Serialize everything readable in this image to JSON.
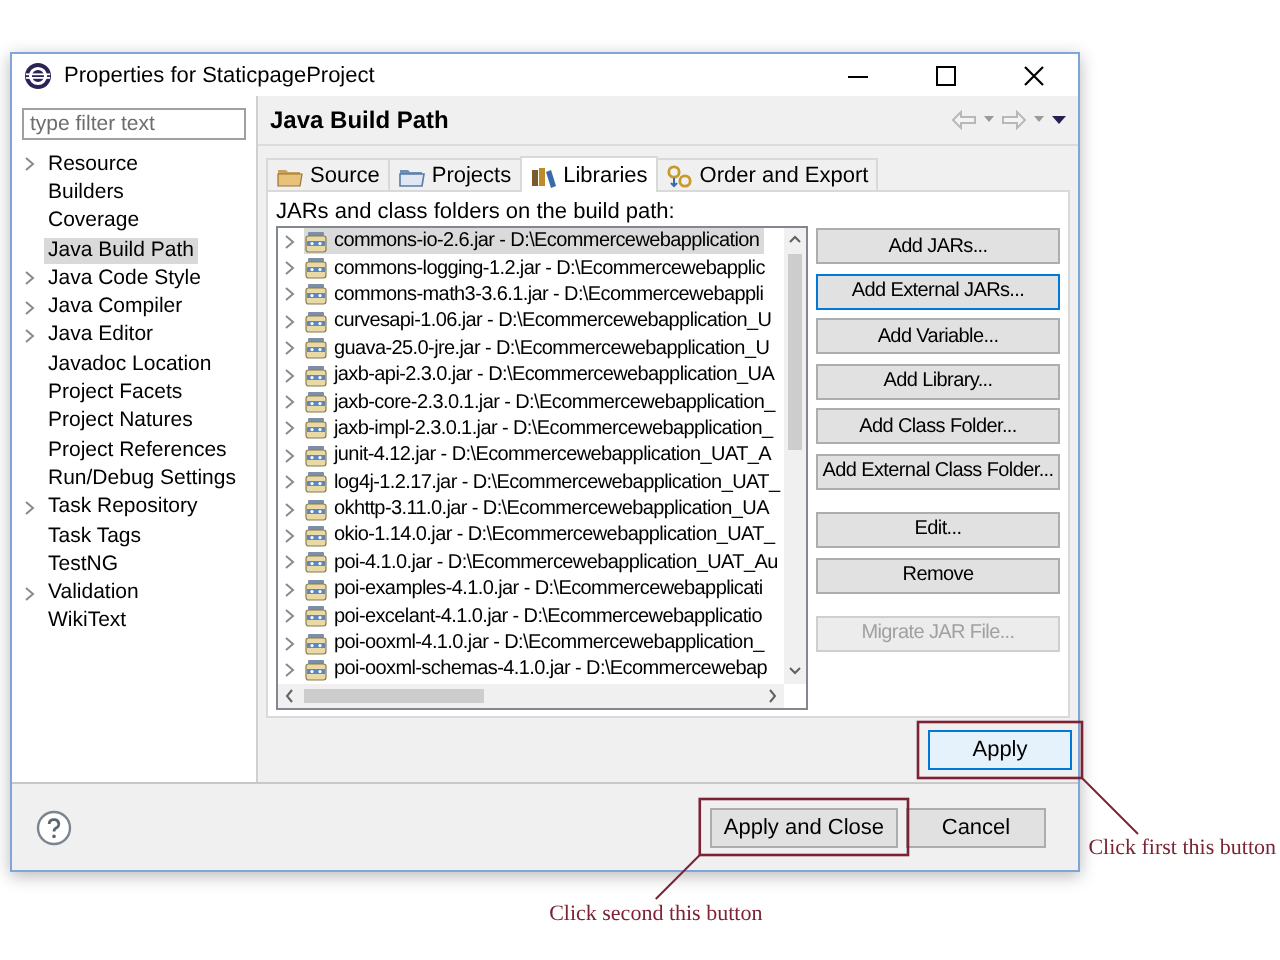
{
  "window": {
    "title": "Properties for StaticpageProject"
  },
  "sidebar": {
    "filter": {
      "placeholder": "type filter text"
    },
    "items": [
      {
        "label": "Resource",
        "expandable": true,
        "selected": false
      },
      {
        "label": "Builders",
        "expandable": false,
        "selected": false
      },
      {
        "label": "Coverage",
        "expandable": false,
        "selected": false
      },
      {
        "label": "Java Build Path",
        "expandable": false,
        "selected": true
      },
      {
        "label": "Java Code Style",
        "expandable": true,
        "selected": false
      },
      {
        "label": "Java Compiler",
        "expandable": true,
        "selected": false
      },
      {
        "label": "Java Editor",
        "expandable": true,
        "selected": false
      },
      {
        "label": "Javadoc Location",
        "expandable": false,
        "selected": false
      },
      {
        "label": "Project Facets",
        "expandable": false,
        "selected": false
      },
      {
        "label": "Project Natures",
        "expandable": false,
        "selected": false
      },
      {
        "label": "Project References",
        "expandable": false,
        "selected": false
      },
      {
        "label": "Run/Debug Settings",
        "expandable": false,
        "selected": false
      },
      {
        "label": "Task Repository",
        "expandable": true,
        "selected": false
      },
      {
        "label": "Task Tags",
        "expandable": false,
        "selected": false
      },
      {
        "label": "TestNG",
        "expandable": false,
        "selected": false
      },
      {
        "label": "Validation",
        "expandable": true,
        "selected": false
      },
      {
        "label": "WikiText",
        "expandable": false,
        "selected": false
      }
    ]
  },
  "page": {
    "title": "Java Build Path",
    "tabs": [
      {
        "label": "Source",
        "kind": "source",
        "selected": false
      },
      {
        "label": "Projects",
        "kind": "projects",
        "selected": false
      },
      {
        "label": "Libraries",
        "kind": "libraries",
        "selected": true
      },
      {
        "label": "Order and Export",
        "kind": "order",
        "selected": false
      }
    ],
    "list_label": "JARs and class folders on the build path:",
    "jars": [
      {
        "name": "commons-io-2.6.jar - D:\\Ecommercewebapplication",
        "selected": true
      },
      {
        "name": "commons-logging-1.2.jar - D:\\Ecommercewebapplic",
        "selected": false
      },
      {
        "name": "commons-math3-3.6.1.jar - D:\\Ecommercewebappli",
        "selected": false
      },
      {
        "name": "curvesapi-1.06.jar - D:\\Ecommercewebapplication_U",
        "selected": false
      },
      {
        "name": "guava-25.0-jre.jar - D:\\Ecommercewebapplication_U",
        "selected": false
      },
      {
        "name": "jaxb-api-2.3.0.jar - D:\\Ecommercewebapplication_UA",
        "selected": false
      },
      {
        "name": "jaxb-core-2.3.0.1.jar - D:\\Ecommercewebapplication_",
        "selected": false
      },
      {
        "name": "jaxb-impl-2.3.0.1.jar - D:\\Ecommercewebapplication_",
        "selected": false
      },
      {
        "name": "junit-4.12.jar - D:\\Ecommercewebapplication_UAT_A",
        "selected": false
      },
      {
        "name": "log4j-1.2.17.jar - D:\\Ecommercewebapplication_UAT_",
        "selected": false
      },
      {
        "name": "okhttp-3.11.0.jar - D:\\Ecommercewebapplication_UA",
        "selected": false
      },
      {
        "name": "okio-1.14.0.jar - D:\\Ecommercewebapplication_UAT_",
        "selected": false
      },
      {
        "name": "poi-4.1.0.jar - D:\\Ecommercewebapplication_UAT_Au",
        "selected": false
      },
      {
        "name": "poi-examples-4.1.0.jar - D:\\Ecommercewebapplicati",
        "selected": false
      },
      {
        "name": "poi-excelant-4.1.0.jar - D:\\Ecommercewebapplicatio",
        "selected": false
      },
      {
        "name": "poi-ooxml-4.1.0.jar - D:\\Ecommercewebapplication_",
        "selected": false
      },
      {
        "name": "poi-ooxml-schemas-4.1.0.jar - D:\\Ecommercewebap",
        "selected": false
      }
    ],
    "button_groups": [
      [
        {
          "label": "Add JARs...",
          "focused": false,
          "disabled": false
        },
        {
          "label": "Add External JARs...",
          "focused": true,
          "disabled": false
        },
        {
          "label": "Add Variable...",
          "focused": false,
          "disabled": false
        },
        {
          "label": "Add Library...",
          "focused": false,
          "disabled": false
        },
        {
          "label": "Add Class Folder...",
          "focused": false,
          "disabled": false
        },
        {
          "label": "Add External Class Folder...",
          "focused": false,
          "disabled": false
        }
      ],
      [
        {
          "label": "Edit...",
          "focused": false,
          "disabled": false
        },
        {
          "label": "Remove",
          "focused": false,
          "disabled": false
        }
      ],
      [
        {
          "label": "Migrate JAR File...",
          "focused": false,
          "disabled": true
        }
      ]
    ],
    "apply": {
      "label": "Apply",
      "focused": true,
      "callout": {
        "text": "Click first this button",
        "kind": "below-right"
      }
    }
  },
  "footer": {
    "buttons": [
      {
        "label": "Apply and Close",
        "callout": {
          "text": "Click second this button",
          "kind": "below-left"
        }
      },
      {
        "label": "Cancel"
      }
    ]
  }
}
